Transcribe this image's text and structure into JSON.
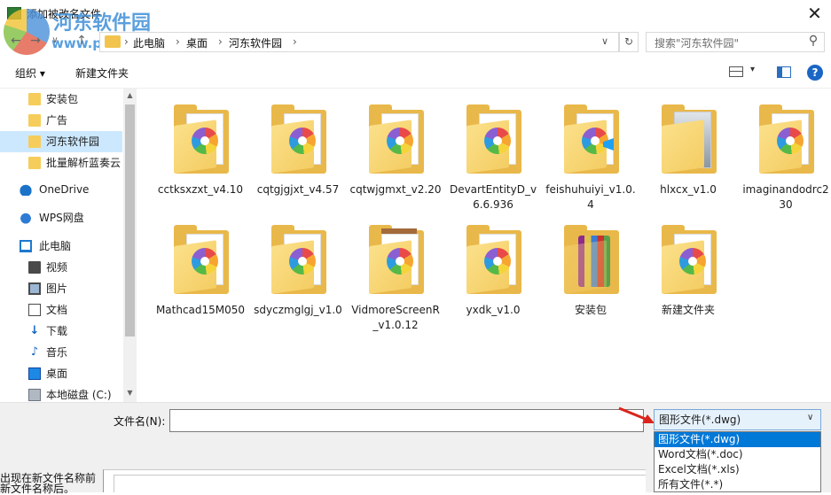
{
  "window": {
    "title": "添加被改名文件",
    "close_glyph": "✕"
  },
  "watermark": {
    "name": "河东软件园",
    "url": "www.pc0359.cn"
  },
  "nav": {
    "back_glyph": "←",
    "forward_glyph": "→",
    "recent_glyph": "∨",
    "up_glyph": "↑",
    "breadcrumb": [
      "此电脑",
      "桌面",
      "河东软件园"
    ],
    "sep_glyph": "›",
    "dropdown_glyph": "∨",
    "refresh_glyph": "↻",
    "search_placeholder": "搜索\"河东软件园\"",
    "search_glyph": "⚲"
  },
  "toolbar": {
    "organize_label": "组织 ▾",
    "new_folder_label": "新建文件夹",
    "view_dd_glyph": "▾",
    "help_glyph": "?"
  },
  "sidebar": {
    "items": [
      {
        "label": "安装包",
        "icon": "folder-icon"
      },
      {
        "label": "广告",
        "icon": "folder-icon"
      },
      {
        "label": "河东软件园",
        "icon": "folder-icon",
        "selected": true
      },
      {
        "label": "批量解析蓝奏云",
        "icon": "folder-icon"
      },
      {
        "label": "OneDrive",
        "icon": "onedrive-icon"
      },
      {
        "label": "WPS网盘",
        "icon": "wps-cloud-icon"
      },
      {
        "label": "此电脑",
        "icon": "computer-icon"
      },
      {
        "label": "视频",
        "icon": "video-icon"
      },
      {
        "label": "图片",
        "icon": "pictures-icon"
      },
      {
        "label": "文档",
        "icon": "documents-icon"
      },
      {
        "label": "下载",
        "icon": "download-icon"
      },
      {
        "label": "音乐",
        "icon": "music-icon"
      },
      {
        "label": "桌面",
        "icon": "desktop-icon"
      },
      {
        "label": "本地磁盘 (C:)",
        "icon": "disk-icon"
      }
    ],
    "scroll_up_glyph": "▲",
    "scroll_down_glyph": "▼",
    "download_glyph": "↓",
    "music_glyph": "♪"
  },
  "files": [
    {
      "name": "cctksxzxt_v4.10"
    },
    {
      "name": "cqtgjgjxt_v4.57"
    },
    {
      "name": "cqtwjgmxt_v2.20"
    },
    {
      "name": "DevartEntityDv6.6.936",
      "display": "DevartEntityD_v6.6.936"
    },
    {
      "name": "feishuhuiyi_v1.0.4"
    },
    {
      "name": "hlxcx_v1.0"
    },
    {
      "name": "imaginandodrc230"
    },
    {
      "name": "Mathcad15M050"
    },
    {
      "name": "sdyczmglgj_v1.0"
    },
    {
      "name": "VidmoreScreenR_v1.0.12"
    },
    {
      "name": "yxdk_v1.0"
    },
    {
      "name": "安装包"
    },
    {
      "name": "新建文件夹"
    }
  ],
  "bottom": {
    "filename_label": "文件名(N):",
    "filename_value": "",
    "file_type_selected": "图形文件(*.dwg)",
    "dropdown_glyph": "∨",
    "file_type_options": [
      "图形文件(*.dwg)",
      "Word文档(*.doc)",
      "Excel文档(*.xls)",
      "所有文件(*.*)"
    ],
    "background_text_1": "出现在新文件名称前",
    "background_text_2": "新文件名称后。"
  },
  "colors": {
    "selection": "#cce8ff",
    "accent": "#0078d7",
    "folder": "#f6cd5a"
  }
}
